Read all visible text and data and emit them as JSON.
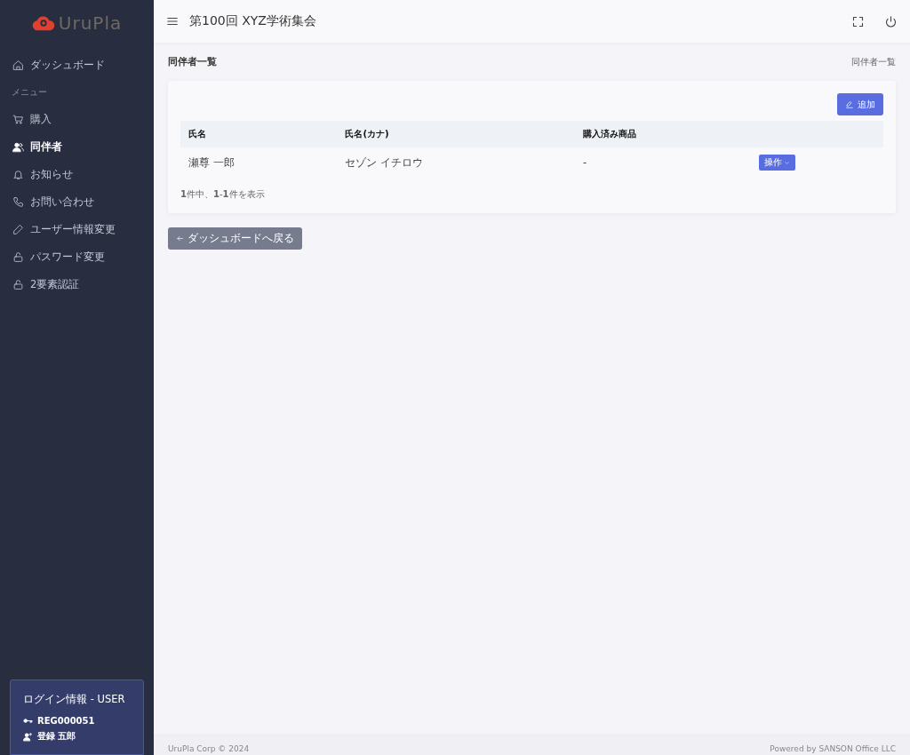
{
  "sidebar": {
    "logo": "UruPla",
    "items": [
      {
        "kind": "link",
        "label": "ダッシュボード",
        "selected": false
      },
      {
        "kind": "section",
        "label": "メニュー"
      },
      {
        "kind": "link",
        "label": "購入",
        "selected": false
      },
      {
        "kind": "link",
        "label": "同伴者",
        "selected": true
      },
      {
        "kind": "link",
        "label": "お知らせ",
        "selected": false
      },
      {
        "kind": "link",
        "label": "お問い合わせ",
        "selected": false
      },
      {
        "kind": "link",
        "label": "ユーザー情報変更",
        "selected": false
      },
      {
        "kind": "link",
        "label": "パスワード変更",
        "selected": false
      },
      {
        "kind": "link",
        "label": "2要素認証",
        "selected": false
      }
    ],
    "login": {
      "title": "ログイン情報 - USER",
      "id": "REG000051",
      "name": "登録 五郎"
    }
  },
  "header": {
    "title": "第100回 XYZ学術集会"
  },
  "page": {
    "title": "同伴者一覧",
    "breadcrumb": "同伴者一覧"
  },
  "card": {
    "add_button": "追加",
    "table": {
      "columns": [
        "氏名",
        "氏名(カナ)",
        "購入済み商品"
      ],
      "rows": [
        {
          "cells": [
            "瀬尊 一郎",
            "セゾン イチロウ",
            "-"
          ],
          "action": "操作"
        }
      ]
    },
    "summary": "**1**件中、**1**-**1**件を表示"
  },
  "back_button": "ダッシュボードへ戻る",
  "footer": {
    "left": "UruPla Corp © 2024",
    "right": "Powered by SANSON Office LLC"
  }
}
